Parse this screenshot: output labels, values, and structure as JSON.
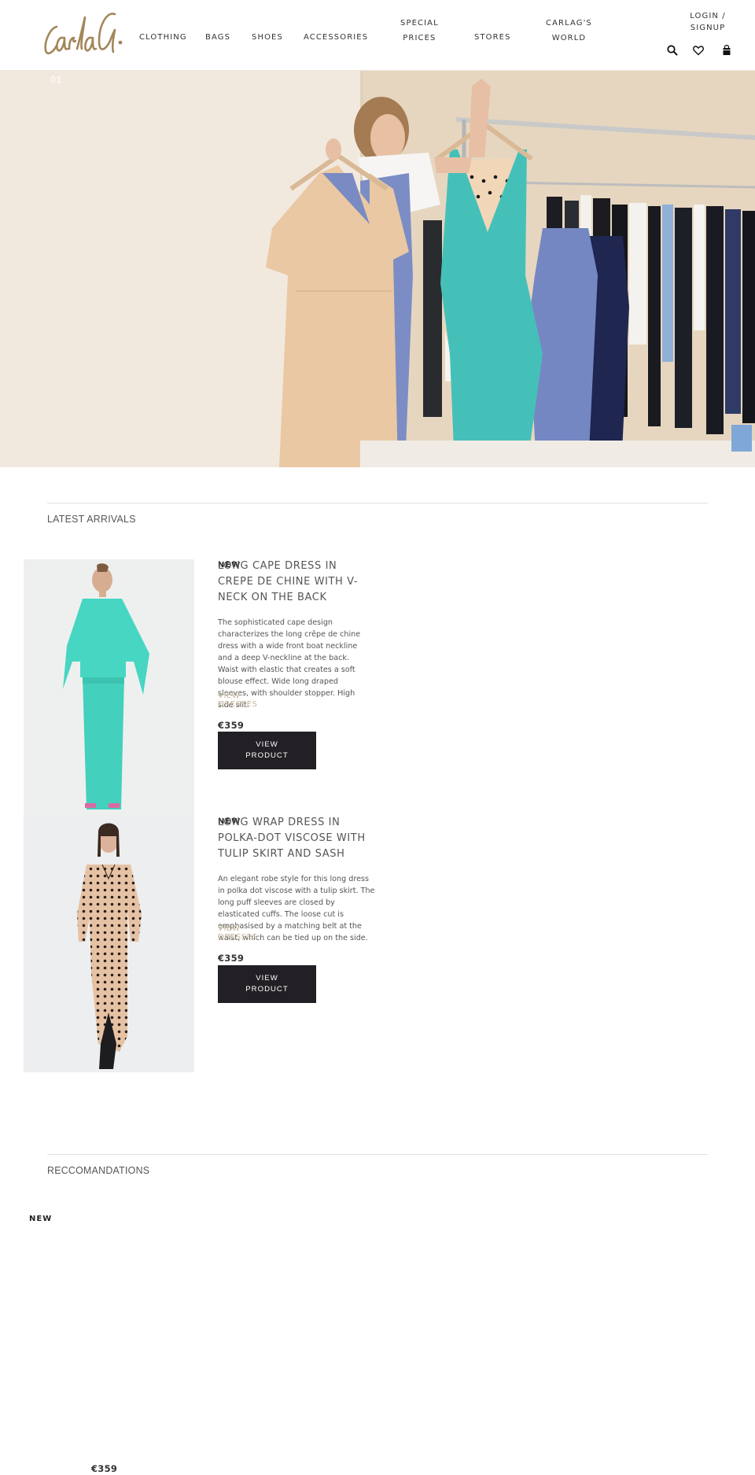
{
  "header": {
    "brand": "CarlaG.",
    "nav": [
      {
        "label": "CLOTHING"
      },
      {
        "label": "BAGS"
      },
      {
        "label": "SHOES"
      },
      {
        "label": "ACCESSORIES"
      },
      {
        "label": "SPECIAL\nPRICES"
      },
      {
        "label": "STORES"
      },
      {
        "label": "CARLAG'S\nWORLD"
      }
    ],
    "login_label": "LOGIN /\nSIGNUP",
    "icons": [
      "search-icon",
      "heart-icon",
      "shopping-bag-icon"
    ]
  },
  "hero": {
    "slide_counter": "01",
    "colors": {
      "wall": "#f1e8dc",
      "peach_dress": "#e9c59f",
      "teal_dress": "#44bfb8",
      "blue_dress": "#7d8fc4",
      "navy": "#1d2447"
    }
  },
  "latest": {
    "title": "LATEST ARRIVALS",
    "products": [
      {
        "badge": "NEW",
        "title": "LONG CAPE DRESS IN CREPE DE CHINE WITH V-NECK ON THE BACK",
        "description": "The sophisticated cape design characterizes the long crêpe de chine dress with a wide front boat neckline and a deep V-neckline at the back. Waist with elastic that creates a soft blouse effect. Wide long draped sleeves, with shoulder stopper. High side slit.",
        "category_link": "VIEW DRESSES",
        "price": "€359",
        "button": "VIEW\nPRODUCT",
        "color": "#46d6c2"
      },
      {
        "badge": "NEW",
        "title": "LONG WRAP DRESS IN POLKA-DOT VISCOSE WITH TULIP SKIRT AND SASH",
        "description": "An elegant robe style for this long dress in polka dot viscose with a tulip skirt. The long puff sleeves are closed by elasticated cuffs. The loose cut is emphasised by a matching belt at the waist, which can be tied up on the side.",
        "category_link": "VIEW DRESSES",
        "price": "€359",
        "button": "VIEW\nPRODUCT",
        "color": "#e6c2a4"
      }
    ]
  },
  "recommendations": {
    "title": "RECCOMANDATIONS",
    "badge": "NEW",
    "price": "€359"
  },
  "colors": {
    "brand_gold": "#a38659",
    "button_dark": "#221f25",
    "link_tan": "#c8b69a"
  }
}
